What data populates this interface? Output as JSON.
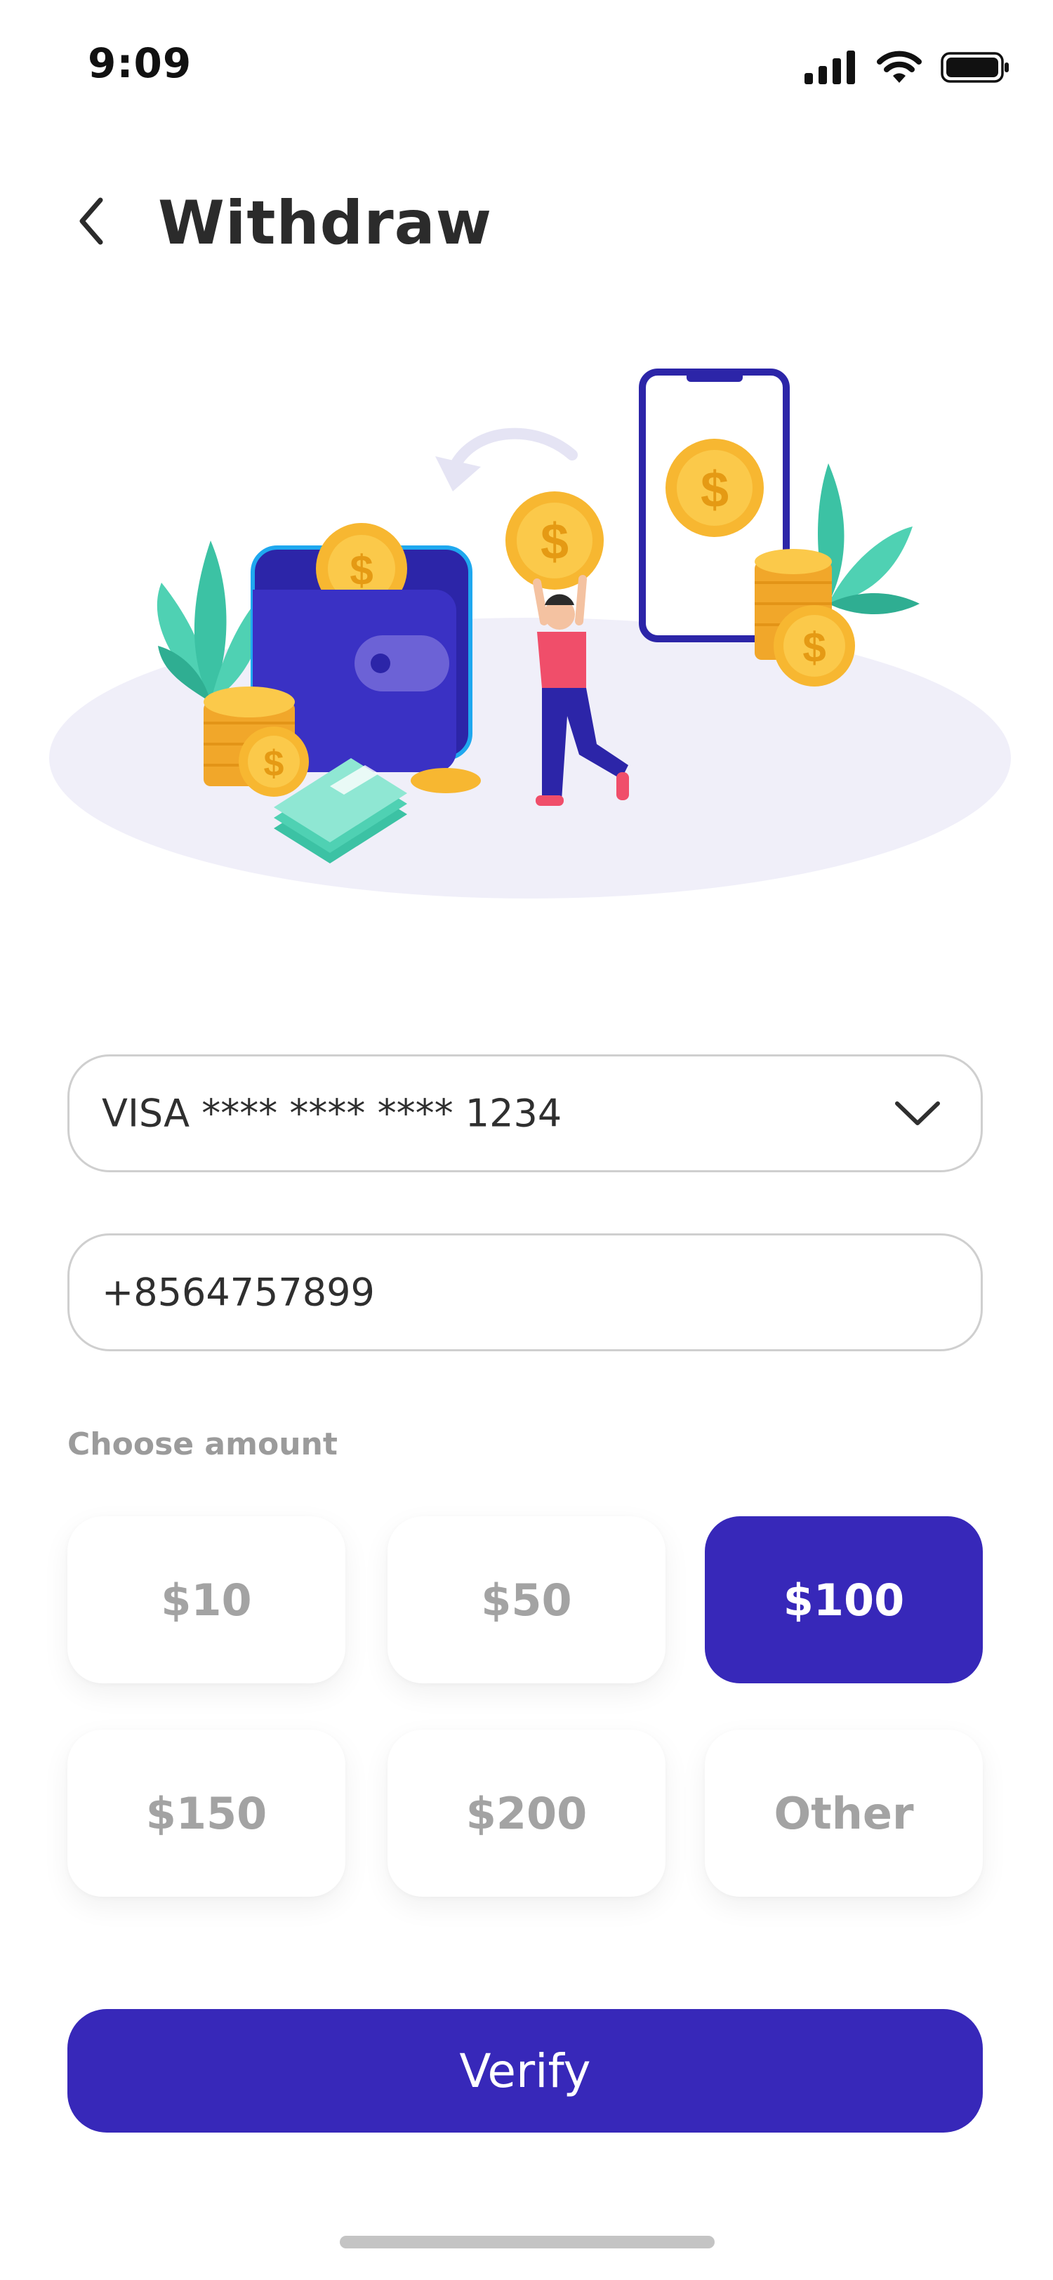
{
  "status_bar": {
    "time": "9:09"
  },
  "header": {
    "title": "Withdraw"
  },
  "form": {
    "card_value": "VISA **** **** **** 1234",
    "phone_value": "+8564757899"
  },
  "amounts": {
    "label": "Choose amount",
    "options": [
      "$10",
      "$50",
      "$100",
      "$150",
      "$200",
      "Other"
    ],
    "selected": "$100"
  },
  "actions": {
    "verify_label": "Verify"
  },
  "colors": {
    "primary": "#3728b9",
    "coin": "#f7b731",
    "leaf": "#4fd1b3",
    "ellipse": "#f0eff9"
  }
}
